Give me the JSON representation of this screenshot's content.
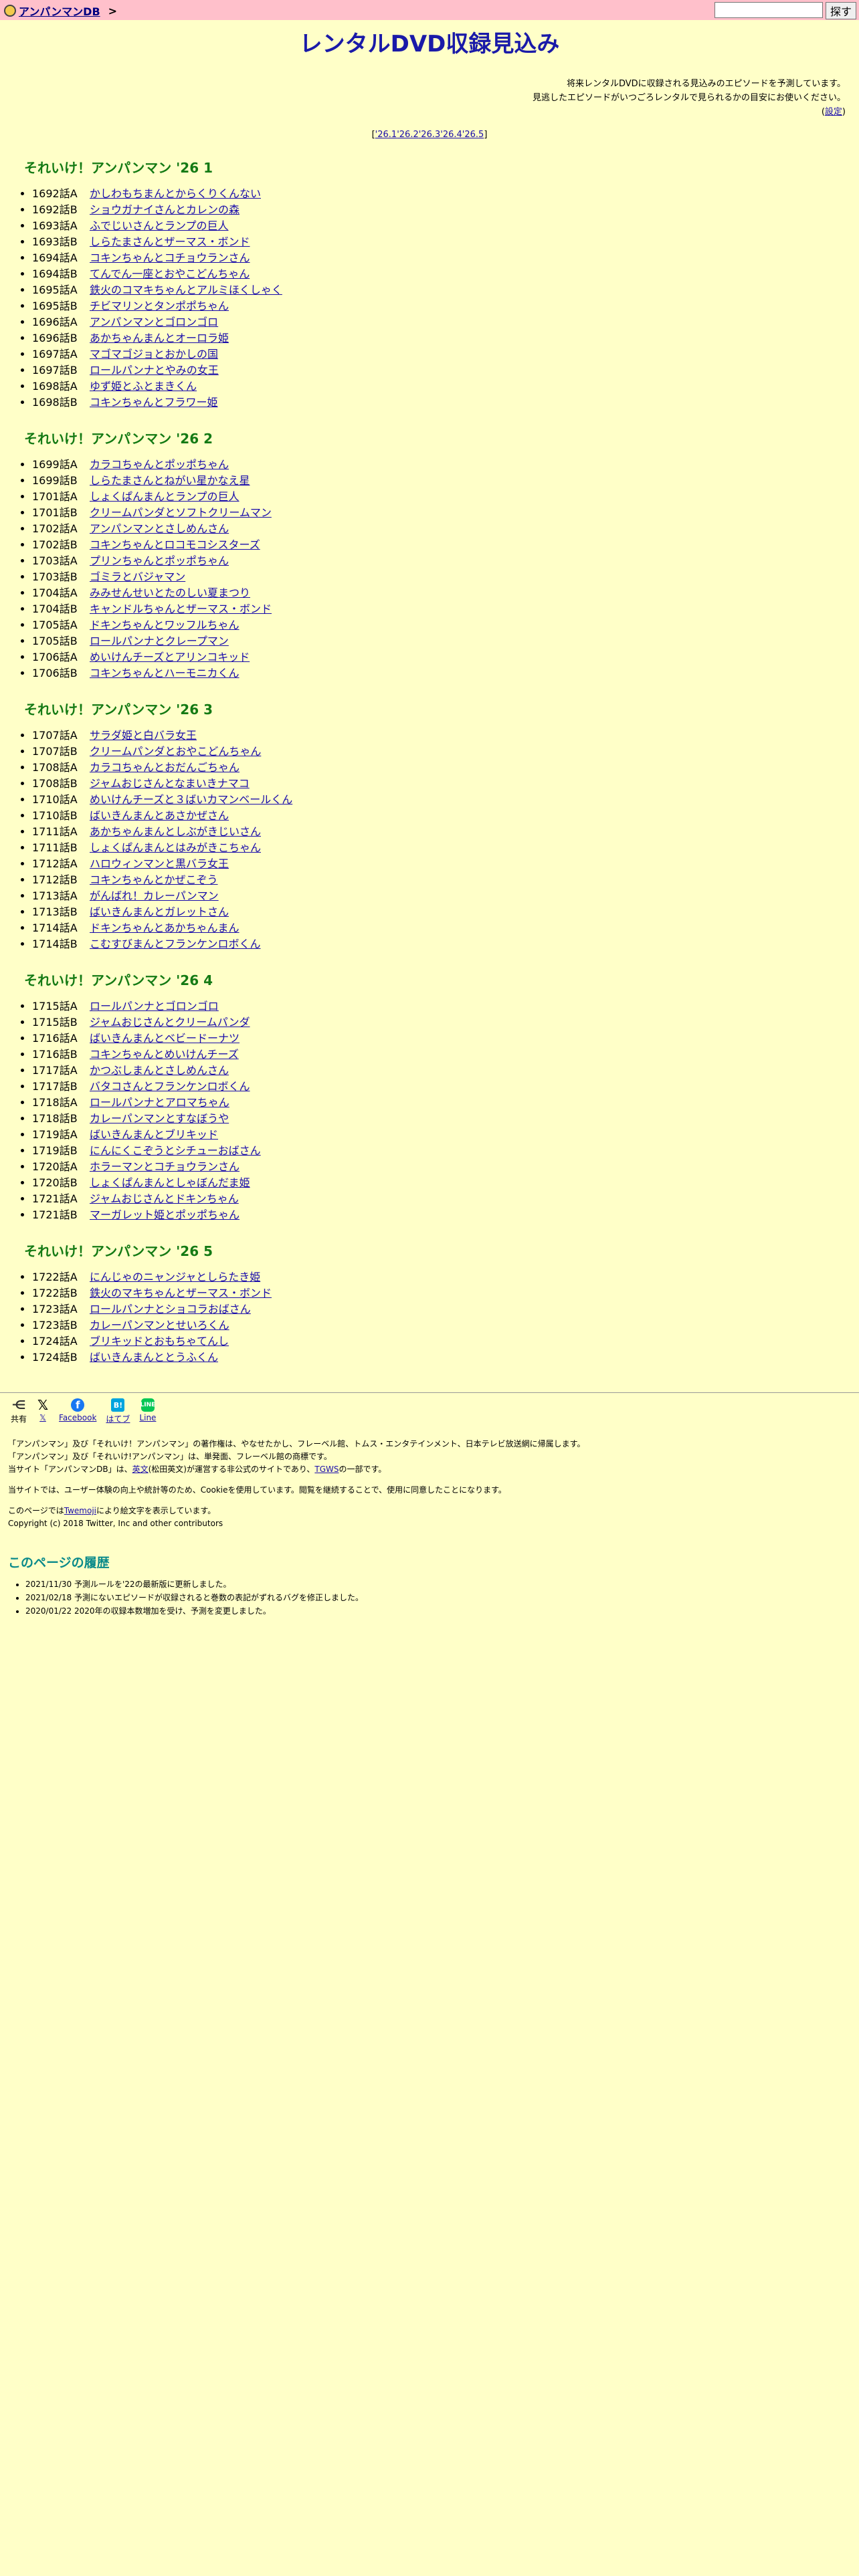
{
  "header": {
    "site_name": "アンパンマンDB",
    "crumb_separator": ">",
    "search_placeholder": "",
    "search_button": "探す"
  },
  "page_title": "レンタルDVD収録見込み",
  "intro": {
    "line1": "将来レンタルDVDに収録される見込みのエピソードを予測しています。",
    "line2": "見逃したエピソードがいつごろレンタルで見られるかの目安にお使いください。",
    "settings_prefix": "(",
    "settings_link": "設定",
    "settings_suffix": ")"
  },
  "jump_links": {
    "open": "[",
    "close": "]",
    "items": [
      "'26.1",
      "'26.2",
      "'26.3",
      "'26.4",
      "'26.5"
    ]
  },
  "seasons": [
    {
      "title": "それいけ！アンパンマン '26 1",
      "episodes": [
        {
          "ep": "1692話A",
          "title": "かしわもちまんとからくりくんない"
        },
        {
          "ep": "1692話B",
          "title": "ショウガナイさんとカレンの森"
        },
        {
          "ep": "1693話A",
          "title": "ふでじいさんとランプの巨人"
        },
        {
          "ep": "1693話B",
          "title": "しらたまさんとザーマス・ボンド"
        },
        {
          "ep": "1694話A",
          "title": "コキンちゃんとコチョウランさん"
        },
        {
          "ep": "1694話B",
          "title": "てんでん一座とおやこどんちゃん"
        },
        {
          "ep": "1695話A",
          "title": "鉄火のコマキちゃんとアルミほくしゃく"
        },
        {
          "ep": "1695話B",
          "title": "チビマリンとタンポポちゃん"
        },
        {
          "ep": "1696話A",
          "title": "アンパンマンとゴロンゴロ"
        },
        {
          "ep": "1696話B",
          "title": "あかちゃんまんとオーロラ姫"
        },
        {
          "ep": "1697話A",
          "title": "マゴマゴジョとおかしの国"
        },
        {
          "ep": "1697話B",
          "title": "ロールパンナとやみの女王"
        },
        {
          "ep": "1698話A",
          "title": "ゆず姫とふとまきくん"
        },
        {
          "ep": "1698話B",
          "title": "コキンちゃんとフラワー姫"
        }
      ]
    },
    {
      "title": "それいけ！アンパンマン '26 2",
      "episodes": [
        {
          "ep": "1699話A",
          "title": "カラコちゃんとポッポちゃん"
        },
        {
          "ep": "1699話B",
          "title": "しらたまさんとねがい星かなえ星"
        },
        {
          "ep": "1701話A",
          "title": "しょくぱんまんとランプの巨人"
        },
        {
          "ep": "1701話B",
          "title": "クリームパンダとソフトクリームマン"
        },
        {
          "ep": "1702話A",
          "title": "アンパンマンとさしめんさん"
        },
        {
          "ep": "1702話B",
          "title": "コキンちゃんとロコモコシスターズ"
        },
        {
          "ep": "1703話A",
          "title": "プリンちゃんとポッポちゃん"
        },
        {
          "ep": "1703話B",
          "title": "ゴミラとバジャマン"
        },
        {
          "ep": "1704話A",
          "title": "みみせんせいとたのしい夏まつり"
        },
        {
          "ep": "1704話B",
          "title": "キャンドルちゃんとザーマス・ボンド"
        },
        {
          "ep": "1705話A",
          "title": "ドキンちゃんとワッフルちゃん"
        },
        {
          "ep": "1705話B",
          "title": "ロールパンナとクレープマン"
        },
        {
          "ep": "1706話A",
          "title": "めいけんチーズとアリンコキッド"
        },
        {
          "ep": "1706話B",
          "title": "コキンちゃんとハーモニカくん"
        }
      ]
    },
    {
      "title": "それいけ！アンパンマン '26 3",
      "episodes": [
        {
          "ep": "1707話A",
          "title": "サラダ姫と白バラ女王"
        },
        {
          "ep": "1707話B",
          "title": "クリームパンダとおやこどんちゃん"
        },
        {
          "ep": "1708話A",
          "title": "カラコちゃんとおだんごちゃん"
        },
        {
          "ep": "1708話B",
          "title": "ジャムおじさんとなまいきナマコ"
        },
        {
          "ep": "1710話A",
          "title": "めいけんチーズと３ばいカマンベールくん"
        },
        {
          "ep": "1710話B",
          "title": "ばいきんまんとあさかぜさん"
        },
        {
          "ep": "1711話A",
          "title": "あかちゃんまんとしぶがきじいさん"
        },
        {
          "ep": "1711話B",
          "title": "しょくぱんまんとはみがきこちゃん"
        },
        {
          "ep": "1712話A",
          "title": "ハロウィンマンと黒バラ女王"
        },
        {
          "ep": "1712話B",
          "title": "コキンちゃんとかぜこぞう"
        },
        {
          "ep": "1713話A",
          "title": "がんばれ！カレーパンマン"
        },
        {
          "ep": "1713話B",
          "title": "ばいきんまんとガレットさん"
        },
        {
          "ep": "1714話A",
          "title": "ドキンちゃんとあかちゃんまん"
        },
        {
          "ep": "1714話B",
          "title": "こむすびまんとフランケンロボくん"
        }
      ]
    },
    {
      "title": "それいけ！アンパンマン '26 4",
      "episodes": [
        {
          "ep": "1715話A",
          "title": "ロールパンナとゴロンゴロ"
        },
        {
          "ep": "1715話B",
          "title": "ジャムおじさんとクリームパンダ"
        },
        {
          "ep": "1716話A",
          "title": "ばいきんまんとベビードーナツ"
        },
        {
          "ep": "1716話B",
          "title": "コキンちゃんとめいけんチーズ"
        },
        {
          "ep": "1717話A",
          "title": "かつぶしまんとさしめんさん"
        },
        {
          "ep": "1717話B",
          "title": "バタコさんとフランケンロボくん"
        },
        {
          "ep": "1718話A",
          "title": "ロールパンナとアロマちゃん"
        },
        {
          "ep": "1718話B",
          "title": "カレーパンマンとすなぼうや"
        },
        {
          "ep": "1719話A",
          "title": "ばいきんまんとブリキッド"
        },
        {
          "ep": "1719話B",
          "title": "にんにくこぞうとシチューおばさん"
        },
        {
          "ep": "1720話A",
          "title": "ホラーマンとコチョウランさん"
        },
        {
          "ep": "1720話B",
          "title": "しょくぱんまんとしゃぼんだま姫"
        },
        {
          "ep": "1721話A",
          "title": "ジャムおじさんとドキンちゃん"
        },
        {
          "ep": "1721話B",
          "title": "マーガレット姫とポッポちゃん"
        }
      ]
    },
    {
      "title": "それいけ！アンパンマン '26 5",
      "episodes": [
        {
          "ep": "1722話A",
          "title": "にんじゃのニャンジャとしらたき姫"
        },
        {
          "ep": "1722話B",
          "title": "鉄火のマキちゃんとザーマス・ボンド"
        },
        {
          "ep": "1723話A",
          "title": "ロールパンナとショコラおばさん"
        },
        {
          "ep": "1723話B",
          "title": "カレーパンマンとせいろくん"
        },
        {
          "ep": "1724話A",
          "title": "ブリキッドとおもちゃてんし"
        },
        {
          "ep": "1724話B",
          "title": "ばいきんまんととうふくん"
        }
      ]
    }
  ],
  "share": [
    {
      "icon": "share-icon",
      "label": "共有",
      "glyph": "⋲"
    },
    {
      "icon": "x-icon",
      "label": "𝕏",
      "glyph": "𝕏"
    },
    {
      "icon": "facebook-icon",
      "label": "Facebook",
      "glyph": "f"
    },
    {
      "icon": "hatena-icon",
      "label": "はてブ",
      "glyph": "B!"
    },
    {
      "icon": "line-icon",
      "label": "Line",
      "glyph": "LINE"
    }
  ],
  "fine_print": {
    "copyright1": "「アンパンマン」及び「それいけ！アンパンマン」の著作権は、やなせたかし、フレーベル館、トムス・エンタテインメント、日本テレビ放送網に帰属します。",
    "copyright2": "「アンパンマン」及び「それいけ!アンパンマン」は、単発面、フレーベル館の商標です。",
    "operator_pre": "当サイト「アンパンマンDB」は、",
    "operator_link": "英文",
    "operator_mid": "(松田英文)が運営する非公式のサイトであり、",
    "operator_link2": "TGWS",
    "operator_post": "の一部です。",
    "cookie": "当サイトでは、ユーザー体験の向上や統計等のため、Cookieを使用しています。閲覧を継続することで、使用に同意したことになります。",
    "font_pre": "このページでは",
    "font_link": "Twemoji",
    "font_post": "により絵文字を表示しています。",
    "twemoji_copyright": "Copyright (c) 2018 Twitter, Inc and other contributors"
  },
  "history": {
    "title": "このページの履歴",
    "items": [
      "2021/11/30 予測ルールを'22の最新版に更新しました。",
      "2021/02/18 予測にないエピソードが収録されると巻数の表記がずれるバグを修正しました。",
      "2020/01/22 2020年の収録本数増加を受け、予測を変更しました。"
    ]
  },
  "colors": {
    "background": "#ffffc8",
    "header_bar": "#ffc0cb",
    "title": "#1a1aa8",
    "season_heading": "#147a14",
    "history_heading": "#0a8a8a",
    "link": "#1a0dab"
  }
}
